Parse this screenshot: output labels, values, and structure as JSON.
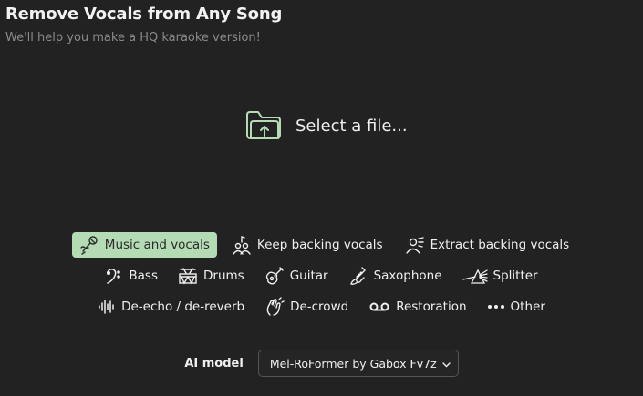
{
  "header": {
    "title": "Remove Vocals from Any Song",
    "subtitle": "We'll help you make a HQ karaoke version!"
  },
  "upload": {
    "label": "Select a file...",
    "icon": "folder-upload-icon"
  },
  "modes": {
    "row1": [
      {
        "label": "Music and vocals",
        "icon": "microphone-icon",
        "selected": true
      },
      {
        "label": "Keep backing vocals",
        "icon": "singers-icon",
        "selected": false
      },
      {
        "label": "Extract backing vocals",
        "icon": "singer-icon",
        "selected": false
      }
    ],
    "row2": [
      {
        "label": "Bass",
        "icon": "bass-clef-icon",
        "selected": false
      },
      {
        "label": "Drums",
        "icon": "drum-icon",
        "selected": false
      },
      {
        "label": "Guitar",
        "icon": "guitar-icon",
        "selected": false
      },
      {
        "label": "Saxophone",
        "icon": "saxophone-icon",
        "selected": false
      },
      {
        "label": "Splitter",
        "icon": "prism-icon",
        "selected": false
      }
    ],
    "row3": [
      {
        "label": "De-echo / de-reverb",
        "icon": "waveform-icon",
        "selected": false
      },
      {
        "label": "De-crowd",
        "icon": "clapping-hands-icon",
        "selected": false
      },
      {
        "label": "Restoration",
        "icon": "tape-icon",
        "selected": false
      },
      {
        "label": "Other",
        "icon": "more-dots-icon",
        "selected": false
      }
    ]
  },
  "model": {
    "label": "AI model",
    "selected": "Mel-RoFormer by Gabox Fv7z"
  },
  "colors": {
    "background": "#222222",
    "accent": "#b4dbb4",
    "upload_icon": "#b4dbb4"
  }
}
